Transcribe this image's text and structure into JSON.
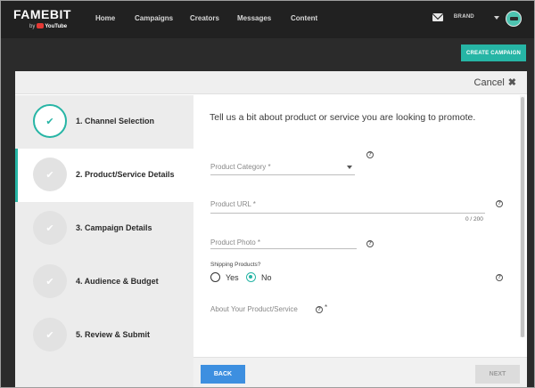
{
  "brand": {
    "word": "FAMEBIT",
    "by": "by",
    "youtube": "YouTube"
  },
  "nav": {
    "items": [
      "Home",
      "Campaigns",
      "Creators",
      "Messages",
      "Content"
    ]
  },
  "user": {
    "name": "ᴮᴿᴬᴺᴰ"
  },
  "create_campaign": "CREATE CAMPAIGN",
  "modal": {
    "cancel": "Cancel",
    "cancel_icon": "✖"
  },
  "steps": [
    {
      "label": "1. Channel Selection",
      "state": "done"
    },
    {
      "label": "2. Product/Service Details",
      "state": "active"
    },
    {
      "label": "3. Campaign Details",
      "state": "pending"
    },
    {
      "label": "4. Audience & Budget",
      "state": "pending"
    },
    {
      "label": "5. Review & Submit",
      "state": "pending"
    }
  ],
  "form": {
    "intro": "Tell us a bit about product or service you are looking to promote.",
    "category_label": "Product Category *",
    "url_label": "Product URL *",
    "url_counter": "0 / 200",
    "photo_label": "Product Photo *",
    "shipping_label": "Shipping Products?",
    "yes": "Yes",
    "no": "No",
    "shipping_selected": "No",
    "about_label": "About Your Product/Service",
    "about_asterisk": "*",
    "help_glyph": "?"
  },
  "footer": {
    "back": "BACK",
    "next": "NEXT"
  },
  "colors": {
    "accent": "#26b5a5",
    "primary": "#3d8fe0",
    "nav_bg": "#212121"
  }
}
